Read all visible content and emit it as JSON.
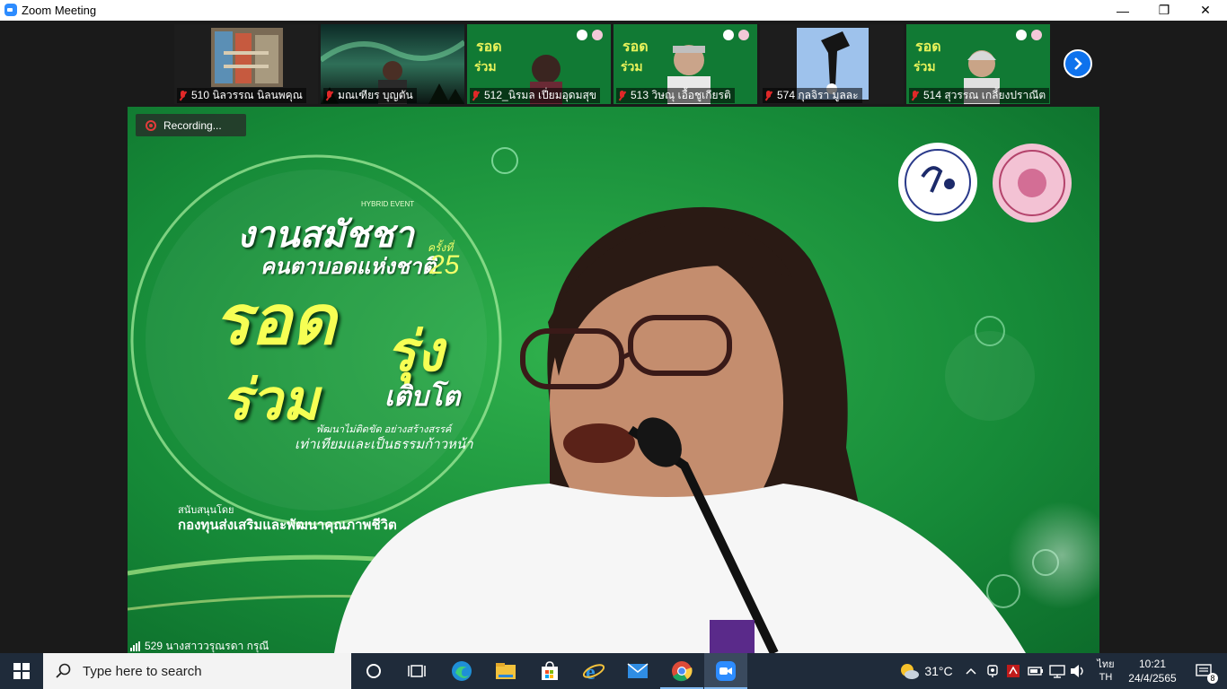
{
  "window": {
    "title": "Zoom Meeting",
    "minimize": "—",
    "restore": "❐",
    "close": "✕"
  },
  "participants": [
    {
      "name": "510 นิลวรรณ นิลนพคุณ",
      "muted": true
    },
    {
      "name": "มณเฑียร บุญตัน",
      "muted": true
    },
    {
      "name": "512_นิรมล เปี่ยมอุดมสุข",
      "muted": true
    },
    {
      "name": "513 วิษณุ เอื้อชูเกียรติ",
      "muted": true
    },
    {
      "name": "574 กุลจิรา มูลละ",
      "muted": true
    },
    {
      "name": "514 สุวรรณ เกลี้ยงปราณีต",
      "muted": true
    }
  ],
  "next_page_icon": "chevron-right-icon",
  "recording": {
    "label": "Recording..."
  },
  "main_video": {
    "speaker_name": "529 นางสาววรุณรดา กรุณี",
    "banner": {
      "event_tag": "HYBRID EVENT",
      "line1": "งานสมัชชา",
      "line2": "คนตาบอดแห่งชาติ",
      "edition_prefix": "ครั้งที่",
      "edition_no": "25",
      "line3": "รอด",
      "line4": "รุ่ง",
      "line5": "ร่วม",
      "line6": "เติบโต",
      "tag1": "พัฒนาไม่ติดขัด อย่างสร้างสรรค์",
      "tag2": "เท่าเทียมและเป็นธรรมก้าวหน้า",
      "sponsor_label": "สนับสนุนโดย",
      "sponsor": "กองทุนส่งเสริมและพัฒนาคุณภาพชีวิต"
    }
  },
  "taskbar": {
    "search_placeholder": "Type here to search",
    "weather": "31°C",
    "lang_top": "ไทย",
    "lang_bottom": "TH",
    "time": "10:21",
    "date": "24/4/2565",
    "notification_count": "8"
  },
  "colors": {
    "zoom_blue": "#2d8cff",
    "next_blue": "#0e72ed",
    "muted_red": "#e02828",
    "banner_green": "#1b8a3a",
    "taskbar": "#1f2b3a"
  }
}
